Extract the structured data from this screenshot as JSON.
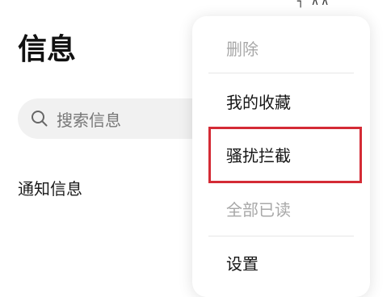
{
  "status_fragment": "┐ ∧∧",
  "page_title": "信息",
  "search": {
    "placeholder": "搜索信息"
  },
  "section": {
    "label": "通知信息"
  },
  "menu": {
    "items": [
      {
        "label": "删除",
        "enabled": false
      },
      {
        "label": "我的收藏",
        "enabled": true
      },
      {
        "label": "骚扰拦截",
        "enabled": true,
        "highlighted": true
      },
      {
        "label": "全部已读",
        "enabled": false
      },
      {
        "label": "设置",
        "enabled": true
      }
    ]
  },
  "colors": {
    "highlight_border": "#d42b35",
    "disabled_text": "#a8a8a8",
    "search_background": "#f1f1f1"
  }
}
